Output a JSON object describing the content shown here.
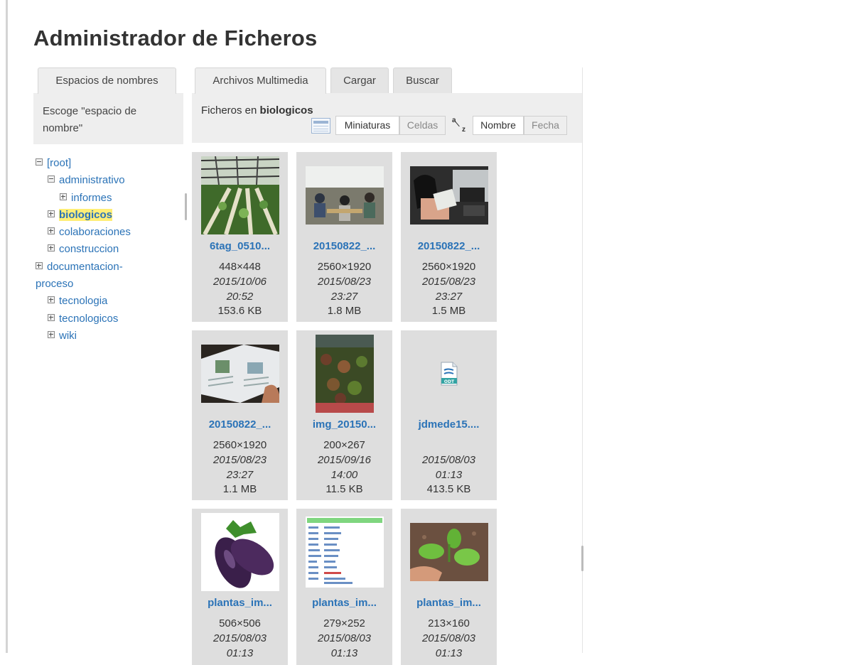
{
  "page": {
    "title": "Administrador de Ficheros"
  },
  "namespace_panel": {
    "tab_label": "Espacios de nombres",
    "prompt": "Escoge \"espacio de nombre\"",
    "tree": [
      {
        "label": "[root]",
        "toggle": "minus",
        "indent": 0,
        "selected": false
      },
      {
        "label": "administrativo",
        "toggle": "minus",
        "indent": 1,
        "selected": false
      },
      {
        "label": "informes",
        "toggle": "plus",
        "indent": 2,
        "selected": false
      },
      {
        "label": "biologicos",
        "toggle": "plus",
        "indent": 1,
        "selected": true
      },
      {
        "label": "colaboraciones",
        "toggle": "plus",
        "indent": 1,
        "selected": false
      },
      {
        "label": "construccion",
        "toggle": "plus",
        "indent": 1,
        "selected": false
      },
      {
        "label": "documentacion-proceso",
        "toggle": "plus",
        "indent": 1,
        "selected": false
      },
      {
        "label": "tecnologia",
        "toggle": "plus",
        "indent": 1,
        "selected": false
      },
      {
        "label": "tecnologicos",
        "toggle": "plus",
        "indent": 1,
        "selected": false
      },
      {
        "label": "wiki",
        "toggle": "plus",
        "indent": 1,
        "selected": false
      }
    ]
  },
  "media_panel": {
    "tabs": [
      "Archivos Multimedia",
      "Cargar",
      "Buscar"
    ],
    "heading_prefix": "Ficheros en",
    "heading_namespace": "biologicos",
    "view_options": [
      "Miniaturas",
      "Celdas"
    ],
    "view_selected": "Miniaturas",
    "sort_icon_letters": [
      "a",
      "z"
    ],
    "sort_options": [
      "Nombre",
      "Fecha"
    ],
    "sort_selected": "Nombre",
    "files": [
      {
        "name": "6tag_0510...",
        "dims": "448×448",
        "date": "2015/10/06",
        "time": "20:52",
        "size": "153.6 KB",
        "thumb": "greenhouse-photo"
      },
      {
        "name": "20150822_...",
        "dims": "2560×1920",
        "date": "2015/08/23",
        "time": "23:27",
        "size": "1.8 MB",
        "thumb": "classroom-photo"
      },
      {
        "name": "20150822_...",
        "dims": "2560×1920",
        "date": "2015/08/23",
        "time": "23:27",
        "size": "1.5 MB",
        "thumb": "student-laptop-photo"
      },
      {
        "name": "20150822_...",
        "dims": "2560×1920",
        "date": "2015/08/23",
        "time": "23:27",
        "size": "1.1 MB",
        "thumb": "booklet-photo"
      },
      {
        "name": "img_20150...",
        "dims": "200×267",
        "date": "2015/09/16",
        "time": "14:00",
        "size": "11.5 KB",
        "thumb": "plants-photo"
      },
      {
        "name": "jdmede15....",
        "dims": "",
        "date": "2015/08/03",
        "time": "01:13",
        "size": "413.5 KB",
        "thumb": "odt-file-icon",
        "thumb_label": "ODT"
      },
      {
        "name": "plantas_im...",
        "dims": "506×506",
        "date": "2015/08/03",
        "time": "01:13",
        "size": "",
        "thumb": "eggplant-photo"
      },
      {
        "name": "plantas_im...",
        "dims": "279×252",
        "date": "2015/08/03",
        "time": "01:13",
        "size": "",
        "thumb": "taxonomy-table-image"
      },
      {
        "name": "plantas_im...",
        "dims": "213×160",
        "date": "2015/08/03",
        "time": "01:13",
        "size": "",
        "thumb": "seedling-photo"
      }
    ]
  },
  "colors": {
    "link": "#2b73b7",
    "panel_bg": "#eeeeee",
    "card_bg": "#dedede",
    "highlight": "#ffee77"
  }
}
